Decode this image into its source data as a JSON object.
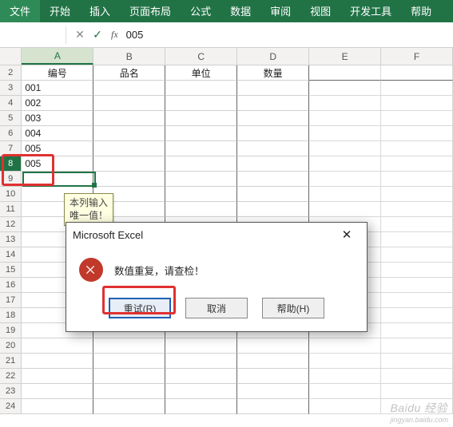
{
  "ribbon": {
    "tabs": [
      "文件",
      "开始",
      "插入",
      "页面布局",
      "公式",
      "数据",
      "审阅",
      "视图",
      "开发工具",
      "帮助"
    ]
  },
  "formulaBar": {
    "cancel_tip": "✕",
    "confirm_tip": "✓",
    "fx_label": "fx",
    "value": "005"
  },
  "columns": [
    "A",
    "B",
    "C",
    "D",
    "E",
    "F"
  ],
  "headersRow": {
    "A": "编号",
    "B": "品名",
    "C": "单位",
    "D": "数量"
  },
  "rows": {
    "3": {
      "A": "001"
    },
    "4": {
      "A": "002"
    },
    "5": {
      "A": "003"
    },
    "6": {
      "A": "004"
    },
    "7": {
      "A": "005"
    },
    "8": {
      "A": "005"
    }
  },
  "rowCount": 24,
  "activeCell": {
    "col": "A",
    "row": 8
  },
  "tooltip": {
    "line1": "本列输入",
    "line2": "唯一值！"
  },
  "dialog": {
    "title": "Microsoft Excel",
    "message": "数值重复，请查检！",
    "btn_retry": "重试(R)",
    "btn_cancel": "取消",
    "btn_help": "帮助(H)"
  },
  "annotations": {
    "redbox_cells": "rows7-8-colA",
    "redbox_button": "retry"
  },
  "watermark": {
    "brand": "Baidu 经验",
    "url": "jingyan.baidu.com"
  }
}
